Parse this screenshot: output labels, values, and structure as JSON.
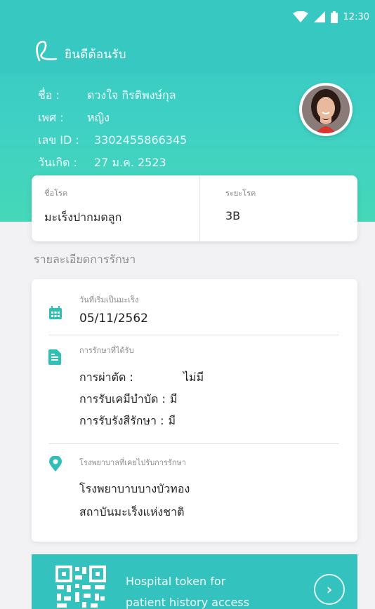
{
  "status_bar": {
    "time": "12:30",
    "icons": [
      "wifi-icon",
      "cell-signal-icon",
      "battery-icon"
    ]
  },
  "header": {
    "welcome": "ยินดีต้อนรับ",
    "logo": "ribbon-icon"
  },
  "patient": {
    "name_label": "ชื่อ :",
    "name_value": "ดวงใจ กิรติพงษ์กุล",
    "gender_label": "เพศ :",
    "gender_value": "หญิง",
    "id_label": "เลข ID :",
    "id_value": "3302455866345",
    "dob_label": "วันเกิด :",
    "dob_value": "27 ม.ค. 2523"
  },
  "disease": {
    "name_label": "ชื่อโรค",
    "name_value": "มะเร็งปากมดลูก",
    "stage_label": "ระยะโรค",
    "stage_value": "3B"
  },
  "section_title": "รายละเอียดการรักษา",
  "details": {
    "start_label": "วันที่เริ่มเป็นมะเร็ง",
    "start_value": "05/11/2562",
    "treatment_label": "การรักษาที่ได้รับ",
    "treatments": [
      {
        "label": "การผ่าตัด :",
        "value": "ไม่มี"
      },
      {
        "label": "การรับเคมีบำบัด :",
        "value": "มี"
      },
      {
        "label": "การรับรังสีรักษา :",
        "value": "มี"
      }
    ],
    "hospital_label": "โรงพยาบาลที่เคยไปรับการรักษา",
    "hospitals": [
      "โรงพยาบาบบางบัวทอง",
      "สถาบันมะเร็งแห่งชาติ"
    ]
  },
  "token": {
    "line1": "Hospital token for",
    "line2": "patient history access",
    "arrow": "›"
  },
  "colors": {
    "primary": "#37c8c2",
    "header_gradient_end": "#45d8b8",
    "background": "#f2f2f4",
    "icon_teal": "#2fbfb7"
  }
}
